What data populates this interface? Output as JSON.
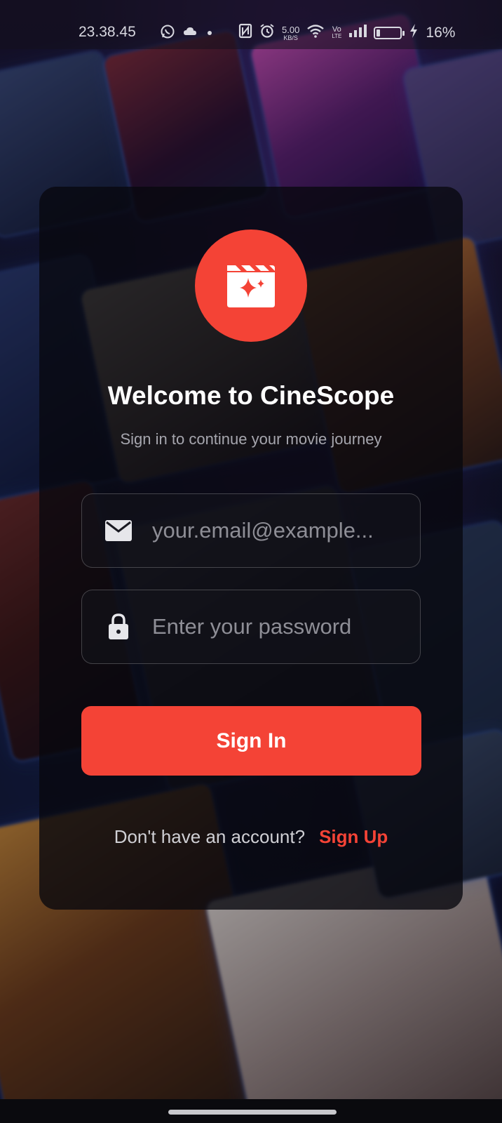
{
  "status_bar": {
    "time": "23.38.45",
    "net_speed_value": "5.00",
    "net_speed_unit": "KB/S",
    "volte_top": "Vo",
    "volte_bottom": "LTE",
    "battery_percent": "16%",
    "battery_level": 0.16,
    "icons": [
      "whatsapp-icon",
      "cloud-icon",
      "dot-icon",
      "nfc-icon",
      "alarm-icon",
      "wifi-icon",
      "signal-icon",
      "battery-icon",
      "charging-icon"
    ]
  },
  "login": {
    "title": "Welcome to CineScope",
    "subtitle": "Sign in to continue your movie journey",
    "email_placeholder": "your.email@example...",
    "password_placeholder": "Enter your password",
    "signin_label": "Sign In",
    "footer_question": "Don't have an account?",
    "signup_label": "Sign Up"
  },
  "colors": {
    "accent": "#f44336",
    "card_bg": "rgba(8,8,14,0.78)",
    "text_primary": "#ffffff",
    "text_secondary": "#a6a6ae"
  }
}
